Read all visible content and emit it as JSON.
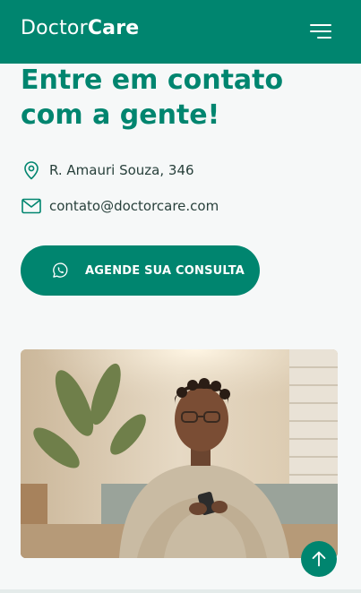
{
  "header": {
    "logo_light": "Doctor",
    "logo_bold": "Care",
    "menu_icon": "hamburger-menu-icon"
  },
  "contact": {
    "headline": "Entre em contato com a gente!",
    "address": "R. Amauri Souza, 346",
    "email": "contato@doctorcare.com",
    "cta_label": "AGENDE SUA CONSULTA",
    "cta_icon": "whatsapp-icon"
  },
  "scroll_top": {
    "icon": "arrow-up-icon"
  },
  "colors": {
    "brand": "#00856F",
    "text": "#28403b",
    "background": "#f6f8f8"
  }
}
